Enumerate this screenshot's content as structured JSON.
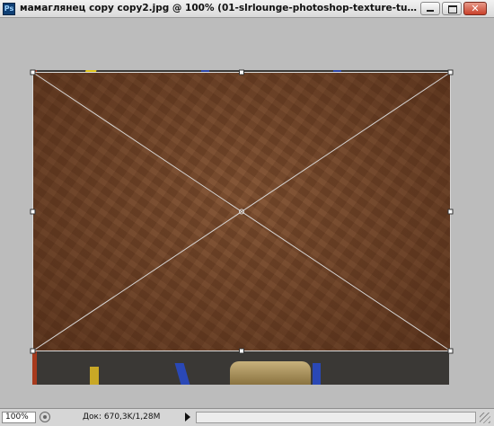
{
  "window": {
    "app_icon_label": "Ps",
    "title": "мамаглянец copy copy2.jpg @ 100% (01-slrlounge-photoshop-texture-tutorial-paper-laye...",
    "close_label": "✕"
  },
  "statusbar": {
    "zoom": "100%",
    "doc_info": "Док: 670,3K/1,28M"
  },
  "colors": {
    "canvas_bg": "#bcbcbc",
    "paper_texture": "#7c4c2d",
    "transform_line": "#d8d8d8"
  }
}
